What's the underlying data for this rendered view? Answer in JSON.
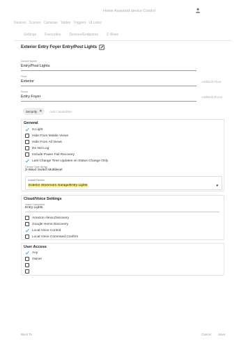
{
  "app": {
    "title": "Home Assistant device Control"
  },
  "main_nav": [
    "Devices",
    "Scenes",
    "Cameras",
    "Tables",
    "Triggers",
    "UI Links"
  ],
  "sub_nav": [
    "Settings",
    "Favourites",
    "Devices/Endpoints",
    "Z-Wave"
  ],
  "device": {
    "title": "Exterior Entry Foyer Entry/Post Lights"
  },
  "fields": {
    "device_name": {
      "label": "Device Name",
      "value": "Entry/Post Lights"
    },
    "floor": {
      "label": "Floor",
      "value": "Exterior",
      "add": "Add/Edit Floor"
    },
    "room": {
      "label": "Room",
      "value": "Entry Foyer",
      "add": "Add/Edit Room"
    }
  },
  "capabilities": {
    "chip": "Security",
    "add": "Add Capabilities"
  },
  "general": {
    "heading": "General",
    "items": [
      {
        "label": "Is Light",
        "checked": true
      },
      {
        "label": "Hide From Mobile Views",
        "checked": false
      },
      {
        "label": "Hide From All Views",
        "checked": false
      },
      {
        "label": "Do Not Log",
        "checked": false
      },
      {
        "label": "Include Power Fail Recovery",
        "checked": false
      },
      {
        "label": "Last Change Time Updates on Status Change Only",
        "checked": true
      }
    ],
    "device_type": {
      "label": "Device Type String",
      "value": "Z-Wave Switch Multilevel"
    },
    "linked_device": {
      "label": "Linked Device",
      "value": "Exterior Storeroom Garage/Entry Lights"
    }
  },
  "cloud": {
    "heading": "Cloud/Voice Settings",
    "voice_command": {
      "label": "Voice Command",
      "value": "Entry Lights"
    },
    "items": [
      {
        "label": "Amazon Alexa Discovery",
        "checked": false
      },
      {
        "label": "Google Home Discovery",
        "checked": false
      },
      {
        "label": "Local Voice Control",
        "checked": true
      },
      {
        "label": "Local Voice Command Confirm",
        "checked": false
      }
    ]
  },
  "user_access": {
    "heading": "User Access",
    "items": [
      {
        "label": "Any",
        "checked": true
      },
      {
        "label": "Owner",
        "checked": false
      },
      {
        "label": "",
        "checked": false
      },
      {
        "label": "",
        "checked": false
      }
    ]
  },
  "footer": {
    "back": "Back To",
    "cancel": "Cancel",
    "save": "Save"
  },
  "colors": {
    "check": "#2196f3",
    "highlight": "#f6f07a",
    "border": "#e2e2e2"
  }
}
